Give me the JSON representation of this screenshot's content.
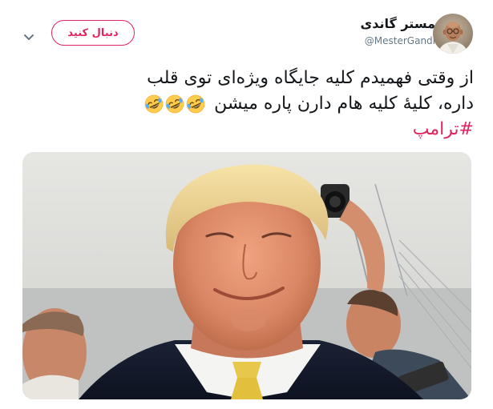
{
  "tweet": {
    "author": {
      "display_name": "مستر گاندی",
      "handle": "@MesterGandi"
    },
    "follow_label": "دنبال کنید",
    "text_lines": [
      "از وقتی فهمیدم کلیه جایگاه ویژه‌ای توی قلب",
      "داره، کلیهٔ کلیه هام دارن پاره میشن"
    ],
    "emoji_icon": "rolling-on-the-floor-laughing-icon",
    "emoji_count": 3,
    "hashtag": "#ترامپ"
  },
  "colors": {
    "accent": "#e0245e",
    "text": "#14171a",
    "muted": "#657786"
  },
  "icons": {
    "menu": "chevron-down-icon",
    "emoji": "rolling-on-the-floor-laughing-icon"
  }
}
